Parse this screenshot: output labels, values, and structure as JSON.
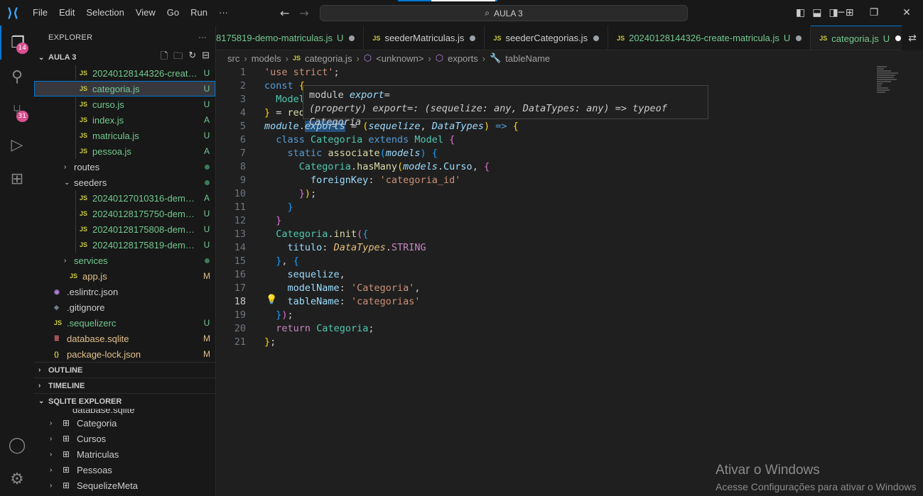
{
  "titlebar": {
    "menu": [
      "File",
      "Edit",
      "Selection",
      "View",
      "Go",
      "Run",
      "···"
    ],
    "search_text": "AULA 3"
  },
  "activity": {
    "explorer_badge": "14",
    "scm_badge": "31"
  },
  "explorer": {
    "header": "EXPLORER",
    "folder": "AULA 3",
    "files": [
      {
        "name": "20240128144326-create-mat...",
        "status": "U",
        "type": "js",
        "color": "green"
      },
      {
        "name": "categoria.js",
        "status": "U",
        "type": "js",
        "color": "green"
      },
      {
        "name": "curso.js",
        "status": "U",
        "type": "js",
        "color": "green"
      },
      {
        "name": "index.js",
        "status": "A",
        "type": "js",
        "color": "green"
      },
      {
        "name": "matricula.js",
        "status": "U",
        "type": "js",
        "color": "green"
      },
      {
        "name": "pessoa.js",
        "status": "A",
        "type": "js",
        "color": "green"
      },
      {
        "name": "routes",
        "status": "",
        "type": "folder",
        "color": "dim"
      },
      {
        "name": "seeders",
        "status": "",
        "type": "folder-open",
        "color": "dim"
      },
      {
        "name": "20240127010316-demo-pess...",
        "status": "A",
        "type": "js",
        "color": "green"
      },
      {
        "name": "20240128175750-demo-cate...",
        "status": "U",
        "type": "js",
        "color": "green"
      },
      {
        "name": "20240128175808-demo-curs...",
        "status": "U",
        "type": "js",
        "color": "green"
      },
      {
        "name": "20240128175819-demo-mat...",
        "status": "U",
        "type": "js",
        "color": "green"
      },
      {
        "name": "services",
        "status": "",
        "type": "folder",
        "color": "green"
      },
      {
        "name": "app.js",
        "status": "M",
        "type": "js",
        "color": "yellow"
      },
      {
        "name": ".eslintrc.json",
        "status": "",
        "type": "eslint",
        "color": "dim"
      },
      {
        "name": ".gitignore",
        "status": "",
        "type": "git",
        "color": "dim"
      },
      {
        "name": ".sequelizerc",
        "status": "U",
        "type": "js",
        "color": "green"
      },
      {
        "name": "database.sqlite",
        "status": "M",
        "type": "db",
        "color": "yellow"
      },
      {
        "name": "package-lock.json",
        "status": "M",
        "type": "json",
        "color": "yellow"
      }
    ],
    "outline": "OUTLINE",
    "timeline": "TIMELINE",
    "sqlite": "SQLITE EXPLORER",
    "sqlite_db": "database.sqlite",
    "tables": [
      "Categoria",
      "Cursos",
      "Matriculas",
      "Pessoas",
      "SequelizeMeta"
    ]
  },
  "tabs": [
    {
      "label": "8175819-demo-matriculas.js",
      "suffix": "U",
      "dot": true,
      "active": false,
      "color": "#73c991"
    },
    {
      "label": "seederMatriculas.js",
      "suffix": "",
      "dot": true,
      "active": false,
      "color": "#cccccc"
    },
    {
      "label": "seederCategorias.js",
      "suffix": "",
      "dot": true,
      "active": false,
      "color": "#cccccc"
    },
    {
      "label": "20240128144326-create-matricula.js",
      "suffix": "U",
      "dot": true,
      "active": false,
      "color": "#73c991"
    },
    {
      "label": "categoria.js",
      "suffix": "U",
      "dot": true,
      "active": true,
      "color": "#73c991"
    }
  ],
  "breadcrumb": [
    "src",
    "models",
    "categoria.js",
    "<unknown>",
    "exports",
    "tableName"
  ],
  "hover": {
    "line1_a": "module",
    "line1_b": " export",
    "line1_c": "=",
    "line2": "(property) export=: (sequelize: any, DataTypes: any) => typeof Categoria"
  },
  "watermark": {
    "title": "Ativar o Windows",
    "subtitle": "Acesse Configurações para ativar o Windows"
  }
}
